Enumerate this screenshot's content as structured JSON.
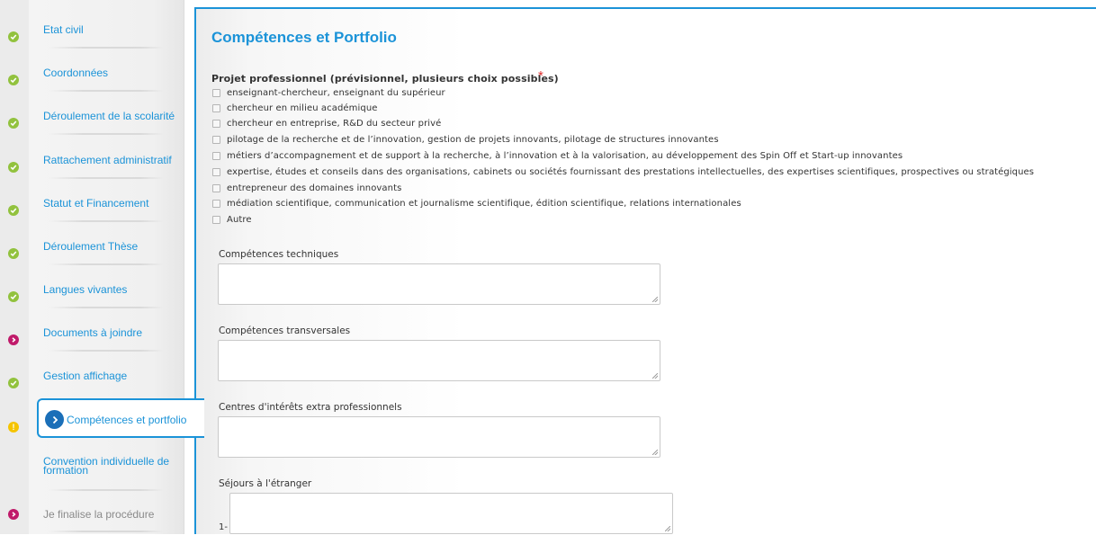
{
  "sidebar": {
    "items": [
      {
        "label": "Etat civil",
        "status": "ok"
      },
      {
        "label": "Coordonnées",
        "status": "ok"
      },
      {
        "label": "Déroulement de la scolarité",
        "status": "ok"
      },
      {
        "label": "Rattachement administratif",
        "status": "ok"
      },
      {
        "label": "Statut et Financement",
        "status": "ok"
      },
      {
        "label": "Déroulement Thèse",
        "status": "ok"
      },
      {
        "label": "Langues vivantes",
        "status": "ok"
      },
      {
        "label": "Documents à joindre",
        "status": "error"
      },
      {
        "label": "Gestion affichage",
        "status": "ok"
      },
      {
        "label": "Compétences et portfolio",
        "status": "warning",
        "active": true
      },
      {
        "label": "Convention individuelle de formation",
        "status": "none"
      },
      {
        "label": "Je finalise la procédure",
        "status": "error"
      }
    ]
  },
  "main": {
    "title": "Compétences et Portfolio",
    "project_question": "Projet professionnel (prévisionnel, plusieurs choix possibles)",
    "required_mark": "*",
    "options": [
      "enseignant-chercheur, enseignant du supérieur",
      "chercheur en milieu académique",
      "chercheur en entreprise, R&D du secteur privé",
      "pilotage de la recherche et de l’innovation, gestion de projets innovants, pilotage de structures innovantes",
      "métiers d’accompagnement et de support à la recherche, à l’innovation et à la valorisation, au développement des Spin Off et Start-up innovantes",
      "expertise, études et conseils dans des organisations, cabinets ou sociétés fournissant des prestations intellectuelles, des expertises scientifiques, prospectives ou stratégiques",
      "entrepreneur des domaines innovants",
      "médiation scientifique, communication et journalisme scientifique, édition scientifique, relations internationales",
      "Autre"
    ],
    "fields": {
      "technical": {
        "label": "Compétences techniques",
        "value": ""
      },
      "transversal": {
        "label": "Compétences transversales",
        "value": ""
      },
      "interests": {
        "label": "Centres d'intérêts extra professionnels",
        "value": ""
      },
      "stays": {
        "label": "Séjours à l'étranger",
        "index": "1-",
        "value": ""
      }
    }
  },
  "colors": {
    "accent": "#1b93d8",
    "ok": "#92c23e",
    "error": "#c01a6a",
    "warning": "#f5c400",
    "required": "#e03131"
  }
}
